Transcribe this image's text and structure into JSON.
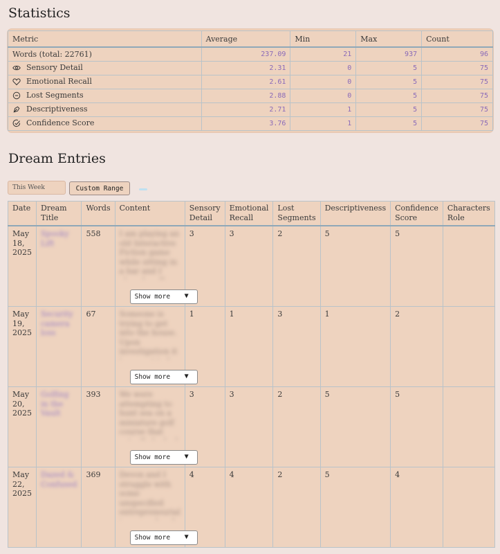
{
  "stats": {
    "title": "Statistics",
    "headers": [
      "Metric",
      "Average",
      "Min",
      "Max",
      "Count"
    ],
    "rows": [
      {
        "icon": "",
        "metric": "Words (total: 22761)",
        "avg": "237.09",
        "min": "21",
        "max": "937",
        "count": "96"
      },
      {
        "icon": "eye-icon",
        "metric": "Sensory Detail",
        "avg": "2.31",
        "min": "0",
        "max": "5",
        "count": "75"
      },
      {
        "icon": "heart-icon",
        "metric": "Emotional Recall",
        "avg": "2.61",
        "min": "0",
        "max": "5",
        "count": "75"
      },
      {
        "icon": "minus-circle-icon",
        "metric": "Lost Segments",
        "avg": "2.88",
        "min": "0",
        "max": "5",
        "count": "75"
      },
      {
        "icon": "pen-tool-icon",
        "metric": "Descriptiveness",
        "avg": "2.71",
        "min": "1",
        "max": "5",
        "count": "75"
      },
      {
        "icon": "check-circle-icon",
        "metric": "Confidence Score",
        "avg": "3.76",
        "min": "1",
        "max": "5",
        "count": "75"
      }
    ]
  },
  "entries": {
    "title": "Dream Entries",
    "filter_input_value": "This Week",
    "custom_range_label": "Custom Range",
    "show_more_label": "Show more",
    "headers": [
      "Date",
      "Dream Title",
      "Words",
      "Content",
      "Sensory Detail",
      "Emotional Recall",
      "Lost Segments",
      "Descriptiveness",
      "Confidence Score",
      "Characters Role"
    ],
    "rows": [
      {
        "date": "May 18, 2025",
        "title": "Spooky Lift",
        "words": "558",
        "content": "I am playing an old Interactive Fiction game while sitting in a bar and I played up Tone Check to tell him about it. He thinks",
        "sensory": "3",
        "emotional": "3",
        "lost": "2",
        "descriptive": "5",
        "confidence": "5",
        "role": ""
      },
      {
        "date": "May 19, 2025",
        "title": "Security camera loss",
        "words": "67",
        "content": "Someone is trying to get into the house. Upon investigation it turns out to be an unhomed guy. I try to help him with",
        "sensory": "1",
        "emotional": "1",
        "lost": "3",
        "descriptive": "1",
        "confidence": "2",
        "role": ""
      },
      {
        "date": "May 20, 2025",
        "title": "Golfing in the Vault",
        "words": "393",
        "content": "We were attempting to hunt sea on a miniature golf course that actually looked more like a normal golf course. We ran",
        "sensory": "3",
        "emotional": "3",
        "lost": "2",
        "descriptive": "5",
        "confidence": "5",
        "role": ""
      },
      {
        "date": "May 22, 2025",
        "title": "Dazed & Confused",
        "words": "369",
        "content": "Devon and I struggle with some unspecified entrepreneurial issue, and end up fighting about it. When we finally hit a wall",
        "sensory": "4",
        "emotional": "4",
        "lost": "2",
        "descriptive": "5",
        "confidence": "4",
        "role": ""
      }
    ]
  },
  "colors": {
    "accent_mono": "#8a6ab8",
    "panel": "#eed3bf",
    "background": "#f0e4e0"
  }
}
